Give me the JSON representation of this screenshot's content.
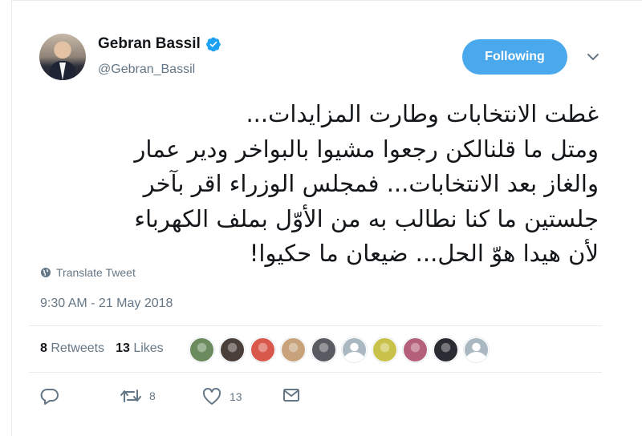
{
  "user": {
    "name": "Gebran Bassil",
    "handle": "@Gebran_Bassil",
    "verified": true
  },
  "follow_button": {
    "label": "Following",
    "color": "#4aa8ec"
  },
  "tweet": {
    "lines": [
      "غطت الانتخابات وطارت المزايدات...",
      "ومتل ما قلنالكن رجعوا مشيوا بالبواخر ودير عمار",
      "والغاز بعد الانتخابات... فمجلس الوزراء اقر بآخر",
      "جلستين ما كنا نطالب به من الأوّل بملف الكهرباء",
      "لأن هيدا هوّ الحل... ضيعان ما حكيوا!"
    ]
  },
  "translate": {
    "label": "Translate Tweet",
    "icon": "globe-icon"
  },
  "timestamp": "9:30 AM - 21 May 2018",
  "stats": {
    "retweets_count": "8",
    "retweets_label": "Retweets",
    "likes_count": "13",
    "likes_label": "Likes"
  },
  "likers": [
    {
      "color": "#6b8a5e"
    },
    {
      "color": "#4a3f39"
    },
    {
      "color": "#d9584c"
    },
    {
      "color": "#c7a27a"
    },
    {
      "color": "#5a5b62"
    },
    {
      "color": "#aab8c2"
    },
    {
      "color": "#c9c24a"
    },
    {
      "color": "#b5607a"
    },
    {
      "color": "#2b2b33"
    },
    {
      "color": "#aab8c2"
    }
  ],
  "actions": {
    "reply": {
      "icon": "reply-icon"
    },
    "retweet": {
      "icon": "retweet-icon",
      "count": "8"
    },
    "like": {
      "icon": "heart-icon",
      "count": "13"
    },
    "message": {
      "icon": "envelope-icon"
    }
  },
  "colors": {
    "accent": "#1da1f2",
    "muted": "#657786",
    "text": "#14171a"
  }
}
